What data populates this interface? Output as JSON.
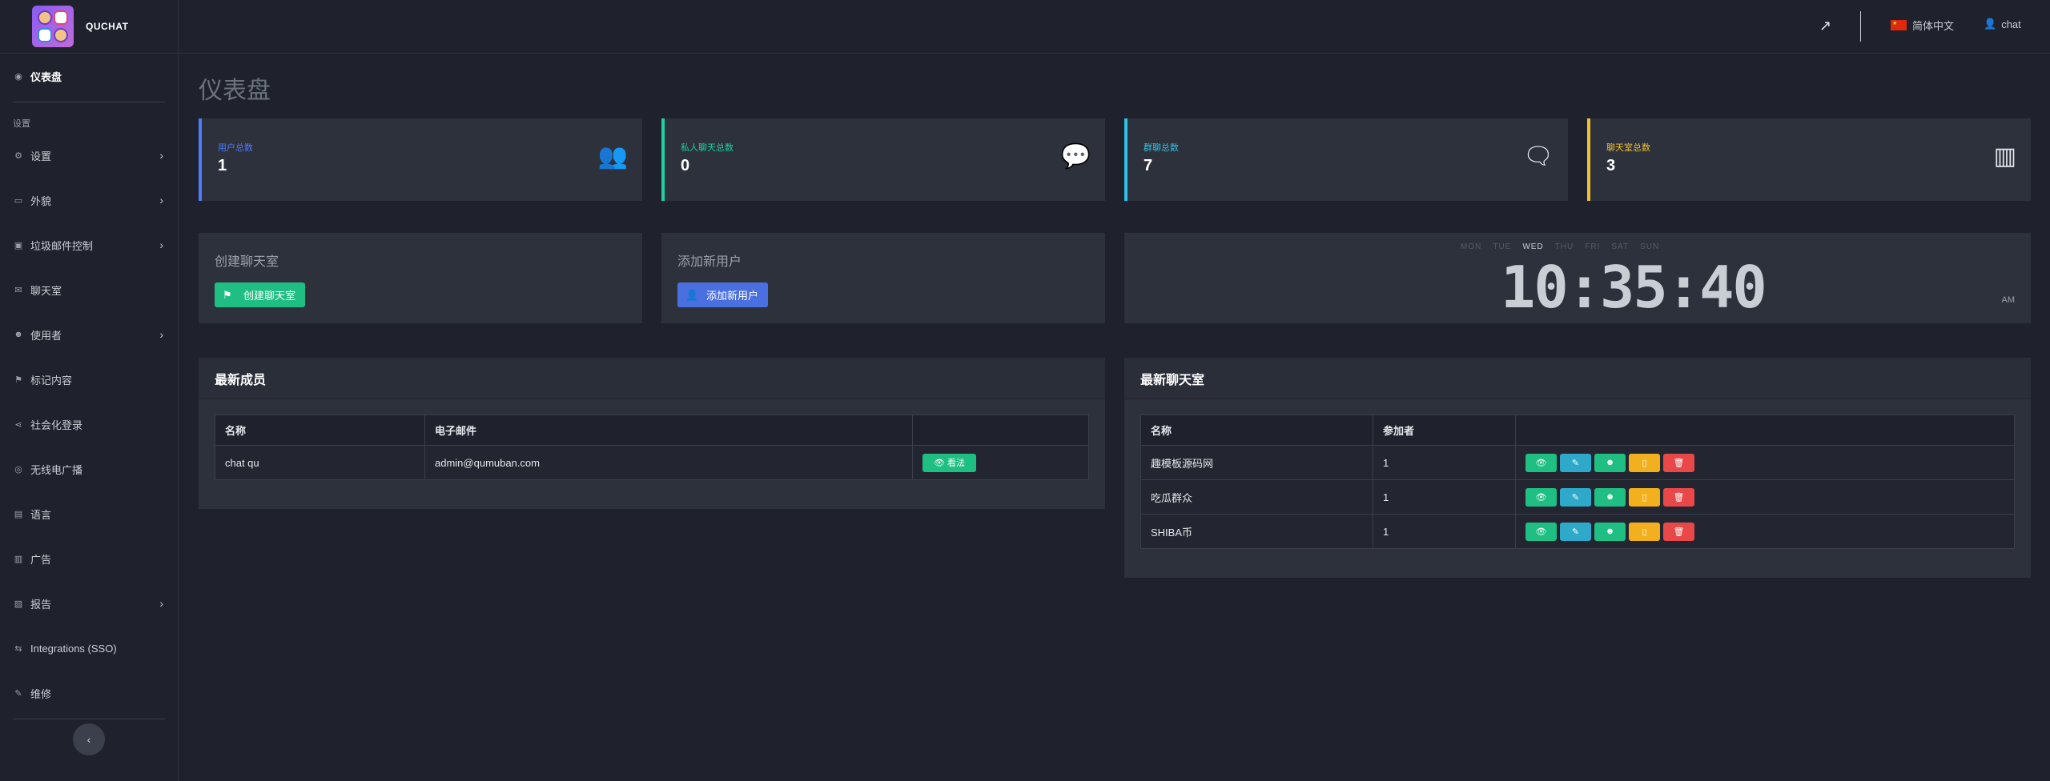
{
  "brand": {
    "name": "QUCHAT"
  },
  "sidebar": {
    "items": [
      {
        "label": "仪表盘",
        "icon": "dashboard-icon",
        "glyph": "◉",
        "active": true,
        "chevron": false
      },
      {
        "section": "设置"
      },
      {
        "label": "设置",
        "icon": "gear-icon",
        "glyph": "⚙",
        "chevron": true
      },
      {
        "label": "外貌",
        "icon": "appearance-icon",
        "glyph": "▭",
        "chevron": true
      },
      {
        "label": "垃圾邮件控制",
        "icon": "shield-icon",
        "glyph": "▣",
        "chevron": true
      },
      {
        "label": "聊天室",
        "icon": "chat-icon",
        "glyph": "✉",
        "chevron": false
      },
      {
        "label": "使用者",
        "icon": "users-icon",
        "glyph": "☻",
        "chevron": true
      },
      {
        "label": "标记内容",
        "icon": "flag-icon",
        "glyph": "⚑",
        "chevron": false
      },
      {
        "label": "社会化登录",
        "icon": "share-icon",
        "glyph": "⋖",
        "chevron": false
      },
      {
        "label": "无线电广播",
        "icon": "radio-icon",
        "glyph": "◎",
        "chevron": false
      },
      {
        "label": "语言",
        "icon": "language-icon",
        "glyph": "▤",
        "chevron": false
      },
      {
        "label": "广告",
        "icon": "ad-icon",
        "glyph": "▥",
        "chevron": false
      },
      {
        "label": "报告",
        "icon": "chart-icon",
        "glyph": "▨",
        "chevron": true
      },
      {
        "label": "Integrations (SSO)",
        "icon": "integrations-icon",
        "glyph": "⇆",
        "chevron": false
      },
      {
        "label": "维修",
        "icon": "wrench-icon",
        "glyph": "✎",
        "chevron": false
      }
    ],
    "chevron_glyph": "›",
    "collapse_glyph": "‹"
  },
  "topbar": {
    "external_icon": "↗",
    "language": "简体中文",
    "user_icon": "👤",
    "user": "chat"
  },
  "page_title": "仪表盘",
  "stats": [
    {
      "label": "用户总数",
      "value": "1",
      "color": "#4d7cff",
      "icon": "users-icon",
      "glyph": "👥"
    },
    {
      "label": "私人聊天总数",
      "value": "0",
      "color": "#1fd1a0",
      "icon": "comment-icon",
      "glyph": "💬"
    },
    {
      "label": "群聊总数",
      "value": "7",
      "color": "#2ec3e6",
      "icon": "comments-icon",
      "glyph": "🗨"
    },
    {
      "label": "聊天室总数",
      "value": "3",
      "color": "#f2c12e",
      "icon": "chalkboard-icon",
      "glyph": "▥"
    }
  ],
  "quick_actions": {
    "create_room": {
      "title": "创建聊天室",
      "button": "创建聊天室",
      "icon": "⚑",
      "color": "#1fbf83"
    },
    "add_user": {
      "title": "添加新用户",
      "button": "添加新用户",
      "icon": "👤",
      "color": "#4a6fe0"
    }
  },
  "clock": {
    "days": [
      "MON",
      "TUE",
      "WED",
      "THU",
      "FRI",
      "SAT",
      "SUN"
    ],
    "active_day": "WED",
    "time": "10:35:40",
    "ampm": "AM"
  },
  "latest_members": {
    "title": "最新成员",
    "columns": [
      "名称",
      "电子邮件",
      ""
    ],
    "rows": [
      {
        "name": "chat qu",
        "email": "admin@qumuban.com",
        "action": "看法",
        "action_icon": "👁"
      }
    ]
  },
  "latest_rooms": {
    "title": "最新聊天室",
    "columns": [
      "名称",
      "参加者",
      ""
    ],
    "rows": [
      {
        "name": "趣模板源码网",
        "participants": "1"
      },
      {
        "name": "吃瓜群众",
        "participants": "1"
      },
      {
        "name": "SHIBA币",
        "participants": "1"
      }
    ],
    "action_glyphs": [
      "👁",
      "✎",
      "☻",
      "▯",
      "🗑"
    ]
  }
}
